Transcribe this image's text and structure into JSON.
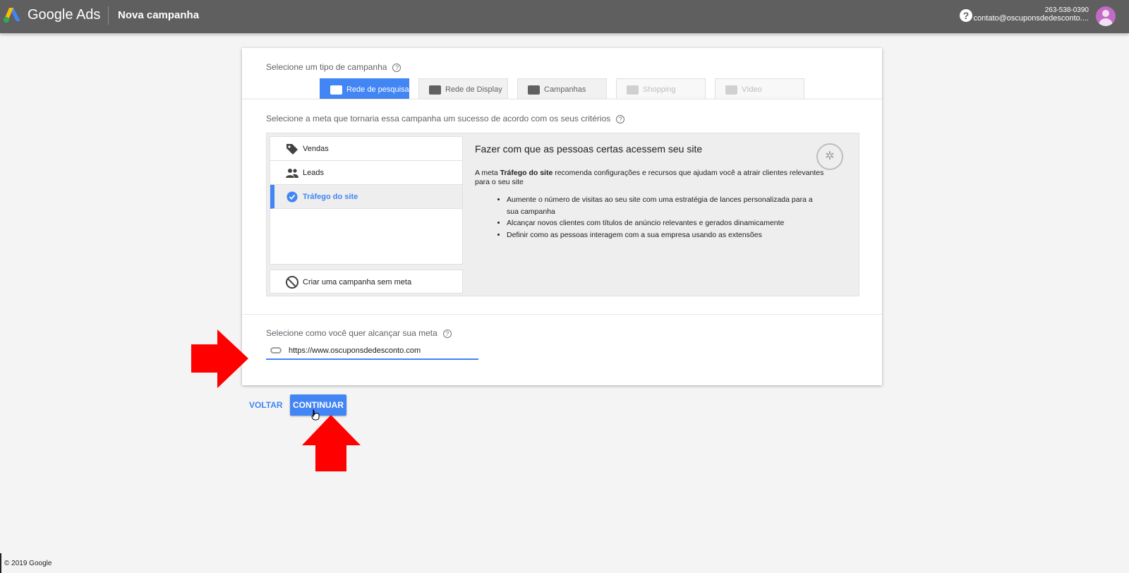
{
  "header": {
    "brand": "Google Ads",
    "page_title": "Nova campanha",
    "account_id": "263-538-0390",
    "account_email": "contato@oscuponsdedesconto...."
  },
  "campaign_type": {
    "label": "Selecione um tipo de campanha",
    "tabs": [
      {
        "label": "Rede de pesquisa",
        "state": "selected",
        "icon": "search-icon"
      },
      {
        "label": "Rede de Display",
        "state": "enabled",
        "icon": "display-icon"
      },
      {
        "label": "Campanhas",
        "state": "enabled",
        "icon": "video-campaign-icon"
      },
      {
        "label": "Shopping",
        "state": "disabled",
        "icon": "shopping-tag-icon"
      },
      {
        "label": "Vídeo",
        "state": "disabled",
        "icon": "video-icon"
      }
    ]
  },
  "goal": {
    "label": "Selecione a meta que tornaria essa campanha um sucesso de acordo com os seus critérios",
    "items": [
      {
        "label": "Vendas",
        "icon": "tag-icon",
        "selected": false
      },
      {
        "label": "Leads",
        "icon": "people-icon",
        "selected": false
      },
      {
        "label": "Tráfego do site",
        "icon": "check-circle-icon",
        "selected": true
      }
    ],
    "no_goal": {
      "label": "Criar uma campanha sem meta",
      "icon": "block-icon"
    },
    "detail": {
      "title": "Fazer com que as pessoas certas acessem seu site",
      "desc_prefix": "A meta ",
      "desc_bold": "Tráfego do site",
      "desc_suffix": " recomenda configurações e recursos que ajudam você a atrair clientes relevantes para o seu site",
      "bullets": [
        "Aumente o número de visitas ao seu site com uma estratégia de lances personalizada para a sua campanha",
        "Alcançar novos clientes com títulos de anúncio relevantes e gerados dinamicamente",
        "Definir como as pessoas interagem com a sua empresa usando as extensões"
      ],
      "icon": "cursor-click-icon"
    }
  },
  "reach": {
    "label": "Selecione como você quer alcançar sua meta",
    "url_value": "https://www.oscuponsdedesconto.com"
  },
  "actions": {
    "back_label": "VOLTAR",
    "continue_label": "CONTINUAR"
  },
  "footer": {
    "copyright": "© 2019 Google"
  },
  "colors": {
    "accent": "#4285f4",
    "topbar": "#5f5f5f",
    "annotation_arrow": "#ff0000"
  }
}
